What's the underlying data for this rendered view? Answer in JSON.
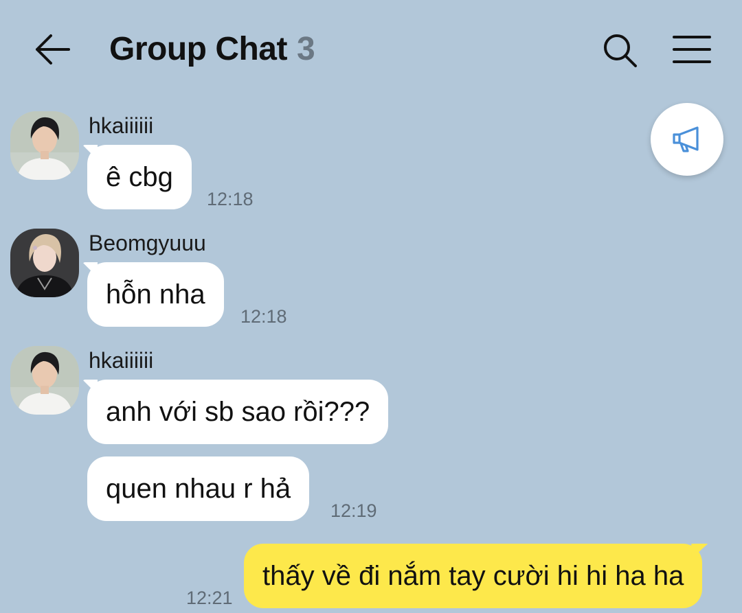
{
  "header": {
    "title": "Group Chat",
    "member_count": "3"
  },
  "colors": {
    "background": "#b2c7d9",
    "incoming_bubble": "#ffffff",
    "outgoing_bubble": "#fde84b",
    "announce_icon": "#4a90d9"
  },
  "icons": {
    "back": "arrow-left-icon",
    "search": "search-icon",
    "menu": "menu-icon",
    "announce": "megaphone-icon"
  },
  "messages": [
    {
      "sender": "hkaiiiiii",
      "avatar": "avatar-hkai",
      "text": "ê cbg",
      "time": "12:18"
    },
    {
      "sender": "Beomgyuuu",
      "avatar": "avatar-beomgyu",
      "text": "hỗn nha",
      "time": "12:18"
    },
    {
      "sender": "hkaiiiiii",
      "avatar": "avatar-hkai",
      "text": "anh với sb sao rồi???",
      "time": ""
    },
    {
      "sender": "",
      "avatar": "",
      "text": "quen nhau r hả",
      "time": "12:19"
    },
    {
      "sender": "me",
      "avatar": "",
      "text": "thấy về đi nắm tay cười hi hi ha ha",
      "time": "12:21"
    }
  ]
}
